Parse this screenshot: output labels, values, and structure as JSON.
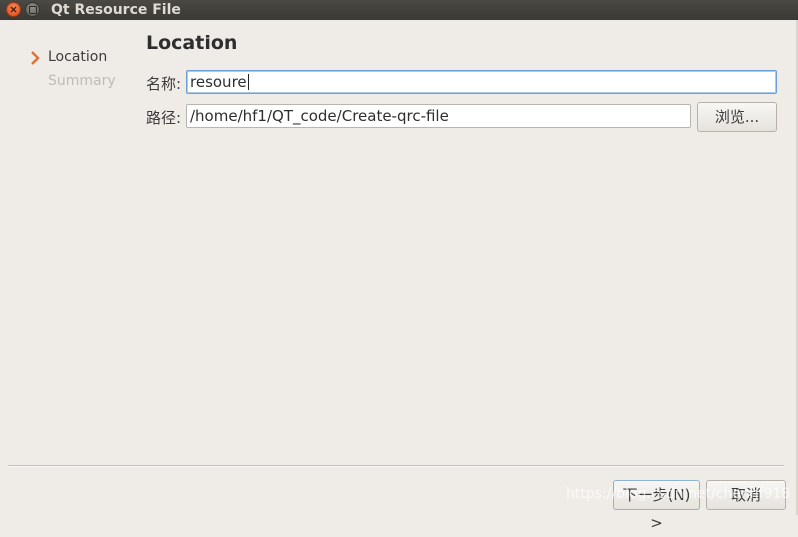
{
  "window": {
    "title": "Qt Resource File",
    "close_icon": "close-icon",
    "maximize_icon": "maximize-icon"
  },
  "steps": [
    {
      "label": "Location",
      "current": true
    },
    {
      "label": "Summary",
      "current": false
    }
  ],
  "page": {
    "title": "Location",
    "name_label": "名称:",
    "name_value": "resoure",
    "path_label": "路径:",
    "path_value": "/home/hf1/QT_code/Create-qrc-file",
    "browse_label": "浏览..."
  },
  "footer": {
    "next_label": "下一步(N) >",
    "cancel_label": "取消"
  },
  "watermark": "https://blog.csdn.net/chenhf918",
  "colors": {
    "background": "#efebe7",
    "titlebar": "#3c3b37",
    "close_button": "#df4a16",
    "focus_border": "#6aa2d6"
  }
}
